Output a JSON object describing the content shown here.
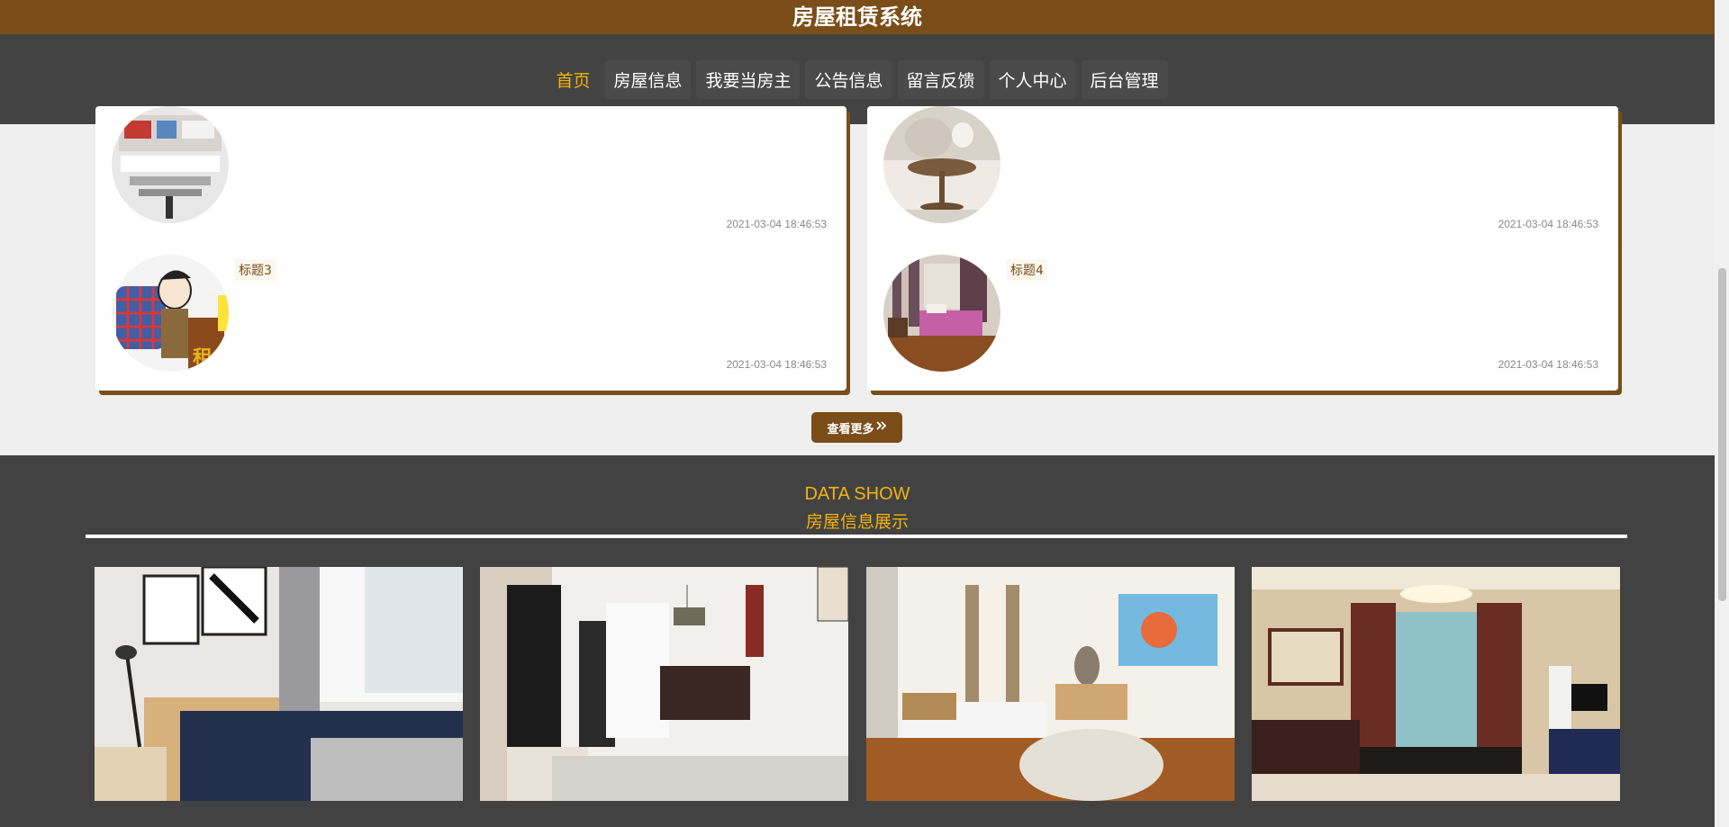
{
  "app": {
    "title": "房屋租赁系统"
  },
  "nav": {
    "items": [
      {
        "label": "首页",
        "active": true
      },
      {
        "label": "房屋信息",
        "active": false
      },
      {
        "label": "我要当房主",
        "active": false
      },
      {
        "label": "公告信息",
        "active": false
      },
      {
        "label": "留言反馈",
        "active": false
      },
      {
        "label": "个人中心",
        "active": false
      },
      {
        "label": "后台管理",
        "active": false
      }
    ]
  },
  "news": {
    "items": [
      {
        "title": "",
        "date": "2021-03-04 18:46:53"
      },
      {
        "title": "",
        "date": "2021-03-04 18:46:53"
      },
      {
        "title": "标题3",
        "date": "2021-03-04 18:46:53"
      },
      {
        "title": "标题4",
        "date": "2021-03-04 18:46:53"
      }
    ],
    "more_label": "查看更多"
  },
  "datashow": {
    "title_en": "DATA SHOW",
    "title_cn": "房屋信息展示"
  },
  "colors": {
    "brand": "#7a4d19",
    "accent": "#f3b30c",
    "nav_bg": "#434343"
  },
  "icons": {
    "more": "double-chevron-right-icon"
  }
}
